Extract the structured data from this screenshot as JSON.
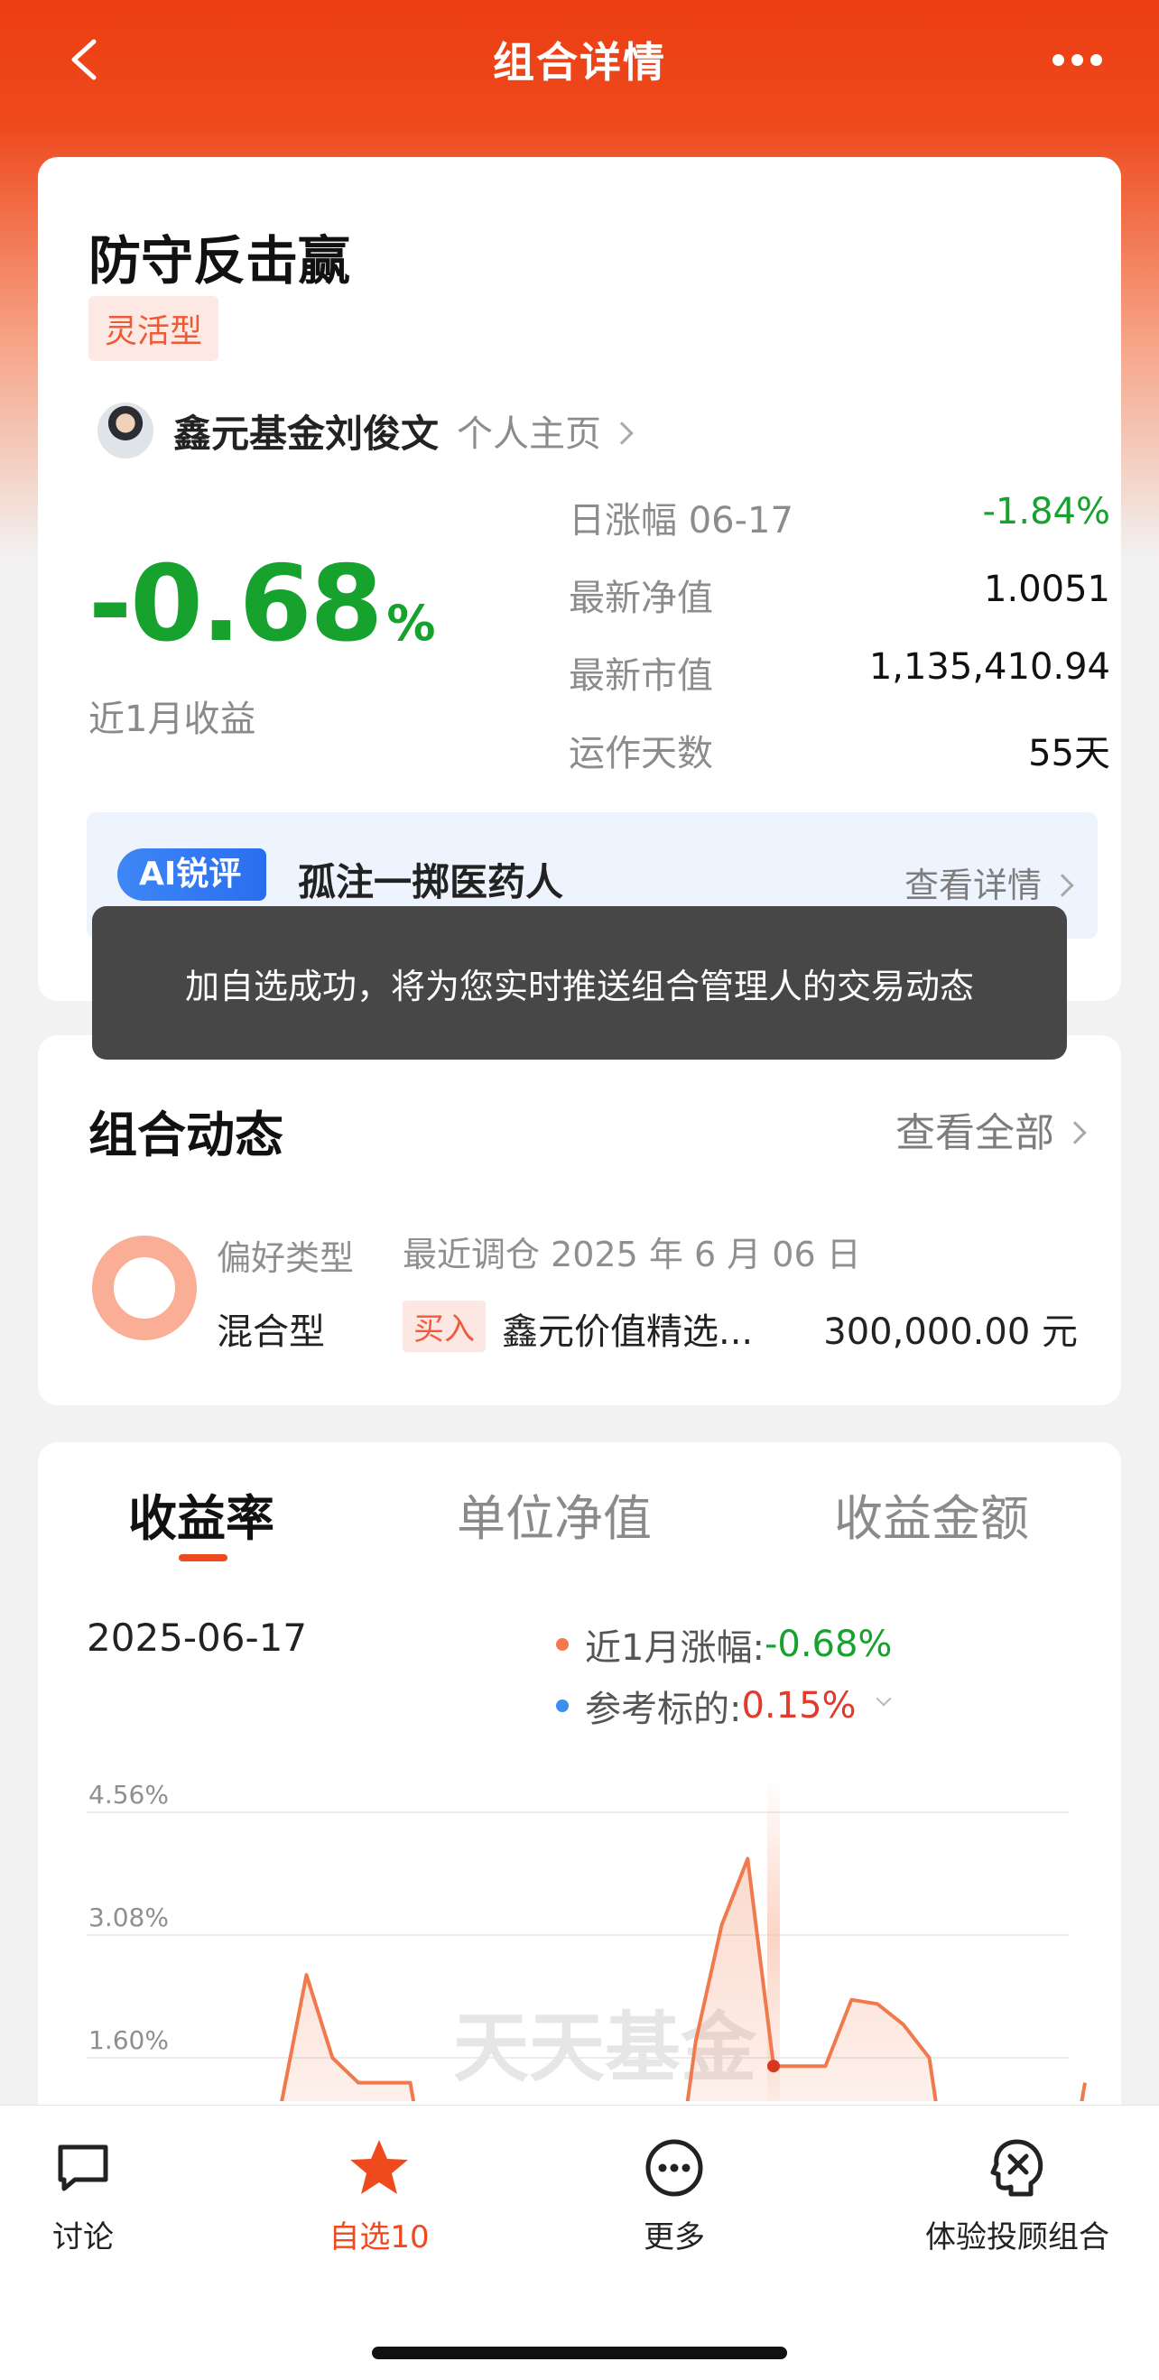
{
  "nav": {
    "title": "组合详情"
  },
  "fund": {
    "name": "防守反击赢",
    "tag": "灵活型",
    "manager": "鑫元基金刘俊文",
    "profile_link": "个人主页",
    "return_value": "-0.68",
    "return_unit": "%",
    "return_label": "近1月收益",
    "stats": [
      {
        "label": "日涨幅 06-17",
        "value": "-1.84%"
      },
      {
        "label": "最新净值",
        "value": "1.0051"
      },
      {
        "label": "最新市值",
        "value": "1,135,410.94"
      },
      {
        "label": "运作天数",
        "value": "55天"
      }
    ],
    "ai": {
      "badge": "AI锐评",
      "text": "孤注一掷医药人",
      "link": "查看详情"
    }
  },
  "toast": "加自选成功，将为您实时推送组合管理人的交易动态",
  "dynamics": {
    "title": "组合动态",
    "link": "查看全部",
    "pref_label": "偏好类型",
    "pref_value": "混合型",
    "recent_label": "最近调仓 2025 年 6 月 06 日",
    "action": "买入",
    "target": "鑫元价值精选...",
    "amount": "300,000.00 元"
  },
  "chart_section": {
    "tabs": [
      "收益率",
      "单位净值",
      "收益金额"
    ],
    "date": "2025-06-17",
    "legend": [
      {
        "label": "近1月涨幅:",
        "value": "-0.68%",
        "color": "#f07a4e"
      },
      {
        "label": "参考标的:",
        "value": "0.15%",
        "color": "#3b8ff0"
      }
    ],
    "watermark": "天天基金"
  },
  "chart_data": {
    "type": "area",
    "yticks": [
      "4.56%",
      "3.08%",
      "1.60%"
    ],
    "ylim": [
      0.0,
      4.56
    ],
    "series": [
      {
        "values": [
          -0.2,
          1.0,
          2.6,
          1.6,
          1.3,
          1.3,
          1.3,
          -0.5,
          -0.5,
          -0.5,
          -0.5,
          -0.5,
          -0.5,
          -0.5,
          -0.5,
          -0.5,
          -0.5,
          1.8,
          3.2,
          4.0,
          1.5,
          1.5,
          1.5,
          2.3,
          2.25,
          2.0,
          1.6,
          -0.5,
          -0.5,
          -0.5,
          -0.5,
          -0.5,
          1.3
        ]
      }
    ],
    "highlight_index": 20
  },
  "tabbar": {
    "items": [
      {
        "label": "讨论",
        "icon": "chat-icon"
      },
      {
        "label": "自选10",
        "icon": "star-icon"
      },
      {
        "label": "更多",
        "icon": "more-icon"
      },
      {
        "label": "体验投顾组合",
        "icon": "advisor-icon"
      }
    ]
  },
  "colors": {
    "brand": "#ec3d12",
    "down_green": "#17a12d",
    "up_red": "#e23a2c",
    "line": "#f07a4e"
  }
}
